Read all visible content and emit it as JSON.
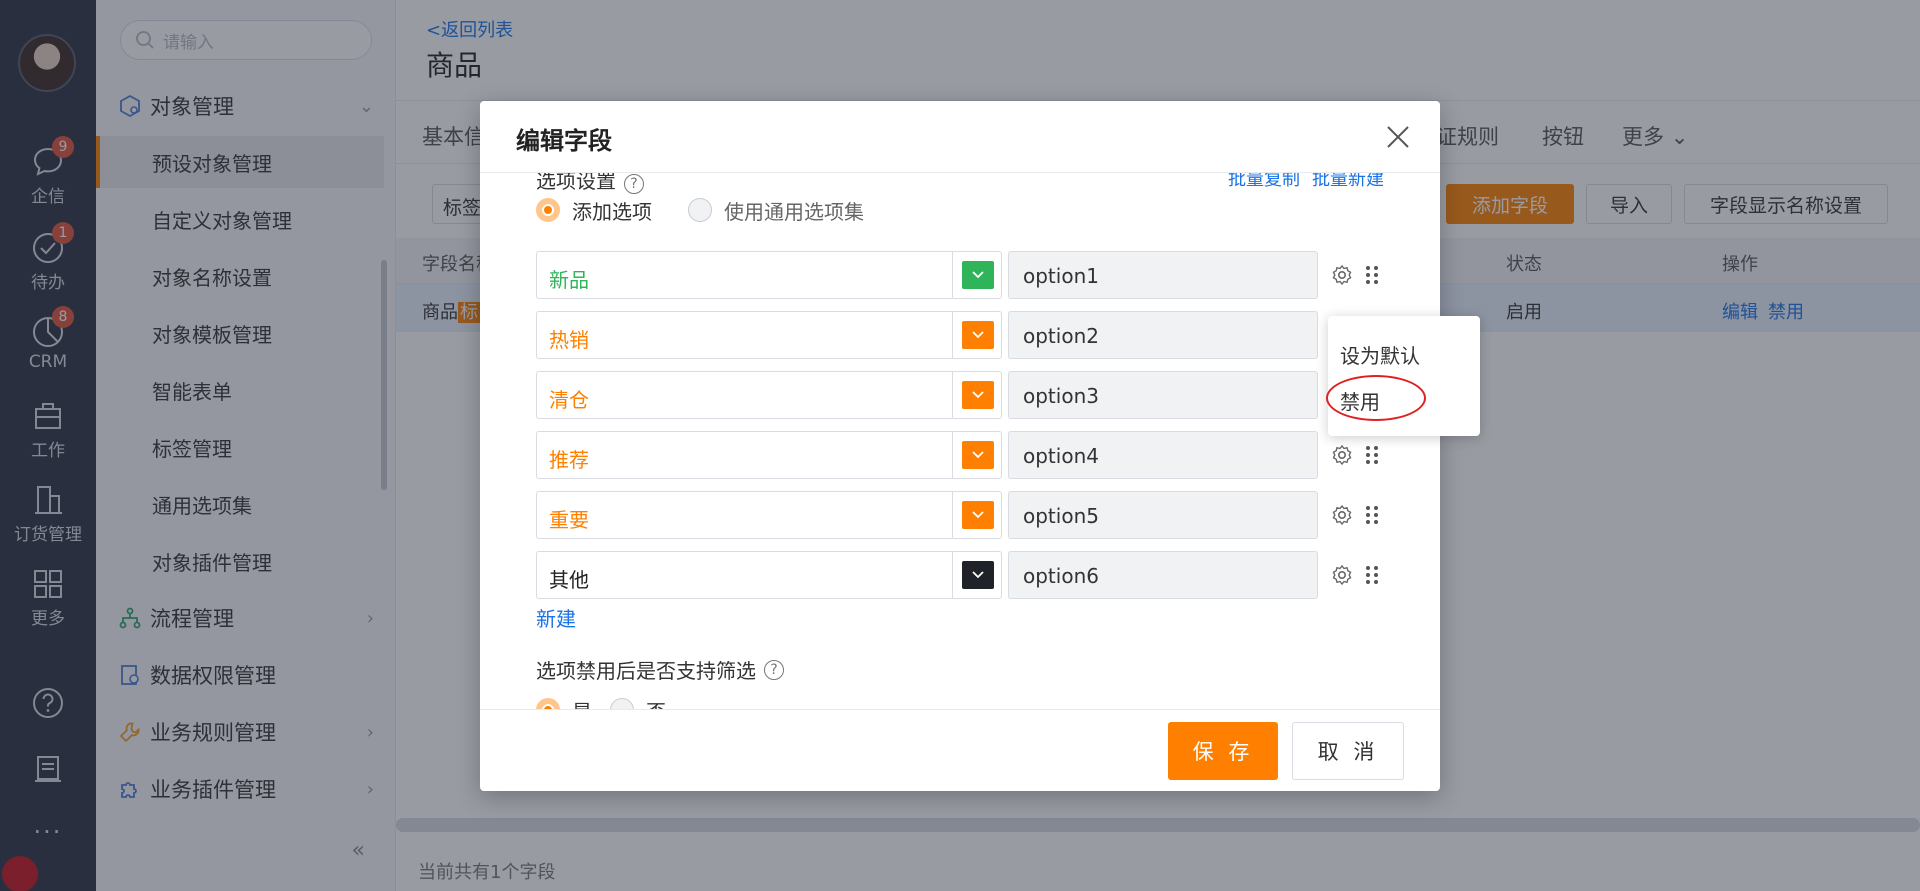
{
  "rail": {
    "items": [
      {
        "label": "企信",
        "icon": "chat-bubble-icon",
        "badge": "9"
      },
      {
        "label": "待办",
        "icon": "check-circle-icon",
        "badge": "1"
      },
      {
        "label": "CRM",
        "icon": "pie-chart-icon",
        "badge": "8"
      },
      {
        "label": "工作",
        "icon": "briefcase-icon",
        "badge": ""
      },
      {
        "label": "订货管理",
        "icon": "building-icon",
        "badge": ""
      },
      {
        "label": "更多",
        "icon": "grid-icon",
        "badge": ""
      }
    ],
    "bottom_icons": [
      "help-icon",
      "document-icon",
      "more-dots-icon"
    ],
    "more_dots": "···"
  },
  "sidebar": {
    "search_placeholder": "请输入",
    "groups": [
      {
        "label": "对象管理",
        "expanded": true
      },
      {
        "label": "流程管理"
      },
      {
        "label": "数据权限管理"
      },
      {
        "label": "业务规则管理"
      },
      {
        "label": "业务插件管理"
      }
    ],
    "items": [
      {
        "label": "预设对象管理",
        "active": true
      },
      {
        "label": "自定义对象管理"
      },
      {
        "label": "对象名称设置"
      },
      {
        "label": "对象模板管理"
      },
      {
        "label": "智能表单"
      },
      {
        "label": "标签管理"
      },
      {
        "label": "通用选项集"
      },
      {
        "label": "对象插件管理"
      }
    ],
    "collapse_glyph": "«"
  },
  "main": {
    "back_link": "<返回列表",
    "title": "商品",
    "tabs": [
      "基本信",
      "证规则",
      "按钮",
      "更多"
    ],
    "tag_select": "标签",
    "buttons": {
      "add_field": "添加字段",
      "import": "导入",
      "display_name": "字段显示名称设置"
    },
    "table": {
      "headers": [
        "字段名称",
        "状态",
        "操作"
      ],
      "row": {
        "name_prefix": "商品",
        "name_highlight": "标",
        "status": "启用",
        "edit": "编辑",
        "disable": "禁用"
      }
    },
    "footer_count": "当前共有1个字段"
  },
  "dialog": {
    "title": "编辑字段",
    "section_label": "选项设置",
    "batch_copy": "批量复制",
    "batch_new": "批量新建",
    "radio_add": "添加选项",
    "radio_common": "使用通用选项集",
    "options": [
      {
        "label": "新品",
        "value": "option1",
        "color": "#2fb45a"
      },
      {
        "label": "热销",
        "value": "option2",
        "color": "#ff8000"
      },
      {
        "label": "清仓",
        "value": "option3",
        "color": "#ff8000"
      },
      {
        "label": "推荐",
        "value": "option4",
        "color": "#ff8000"
      },
      {
        "label": "重要",
        "value": "option5",
        "color": "#ff8000"
      },
      {
        "label": "其他",
        "value": "option6",
        "color": "#1f2229"
      }
    ],
    "new_link": "新建",
    "filter_question": "选项禁用后是否支持筛选",
    "filter_yes": "是",
    "filter_no": "否",
    "save": "保 存",
    "cancel": "取 消"
  },
  "popover": {
    "set_default": "设为默认",
    "disable": "禁用"
  },
  "colors": {
    "accent": "#ff8000",
    "link": "#1a73e8",
    "rail_bg": "#2b3040"
  }
}
